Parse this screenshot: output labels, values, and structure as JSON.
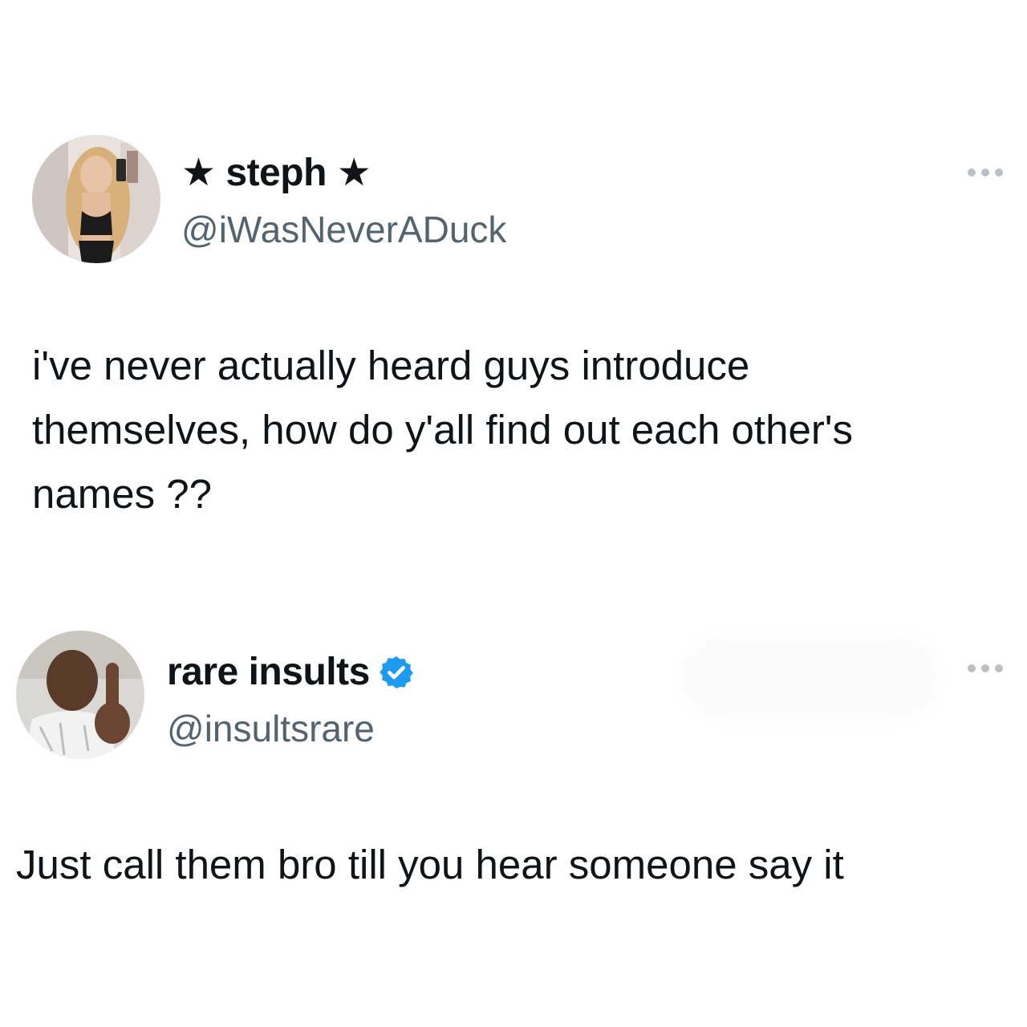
{
  "tweets": [
    {
      "display_name": "★ steph ★",
      "handle": "@iWasNeverADuck",
      "verified": false,
      "text_lines": [
        "i've never actually heard guys introduce",
        "themselves, how do y'all find out each other's",
        "names ??"
      ]
    },
    {
      "display_name": "rare insults",
      "handle": "@insultsrare",
      "verified": true,
      "text_lines": [
        "Just call them bro till you hear someone say it"
      ]
    }
  ],
  "colors": {
    "text": "#0f1419",
    "handle": "#536471",
    "verified": "#1d9bf0",
    "more_dots": "#b9c0c6"
  },
  "icons": {
    "more": "more-horizontal-icon",
    "verified": "verified-badge-icon"
  }
}
